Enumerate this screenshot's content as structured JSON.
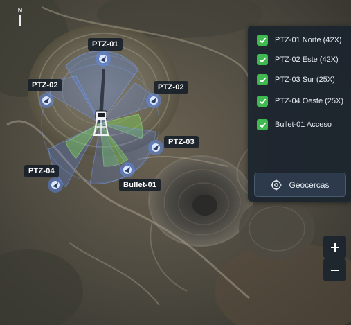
{
  "map": {
    "north_label": "N",
    "cameras": [
      {
        "id": "ptz01",
        "label": "PTZ-01"
      },
      {
        "id": "ptz02w",
        "label": "PTZ-02"
      },
      {
        "id": "ptz02e",
        "label": "PTZ-02"
      },
      {
        "id": "ptz03",
        "label": "PTZ-03"
      },
      {
        "id": "ptz04",
        "label": "PTZ-04"
      },
      {
        "id": "bullet01",
        "label": "Bullet-01"
      }
    ]
  },
  "layers_panel": {
    "items": [
      {
        "label": "PTZ-01 Norte (42X)",
        "checked": true
      },
      {
        "label": "PTZ-02 Este (42X)",
        "checked": true
      },
      {
        "label": "PTZ-03 Sur (25X)",
        "checked": true
      },
      {
        "label": "PTZ-04 Oeste (25X)",
        "checked": true
      },
      {
        "label": "Bullet-01 Acceso",
        "checked": true
      }
    ],
    "geofences_label": "Geocercas"
  },
  "zoom": {
    "in_icon": "plus-icon",
    "out_icon": "minus-icon"
  },
  "colors": {
    "checkbox": "#3fb950",
    "coverage_blue": "#5b8dff",
    "coverage_green": "#7ed957",
    "panel_bg": "#1c242e"
  }
}
